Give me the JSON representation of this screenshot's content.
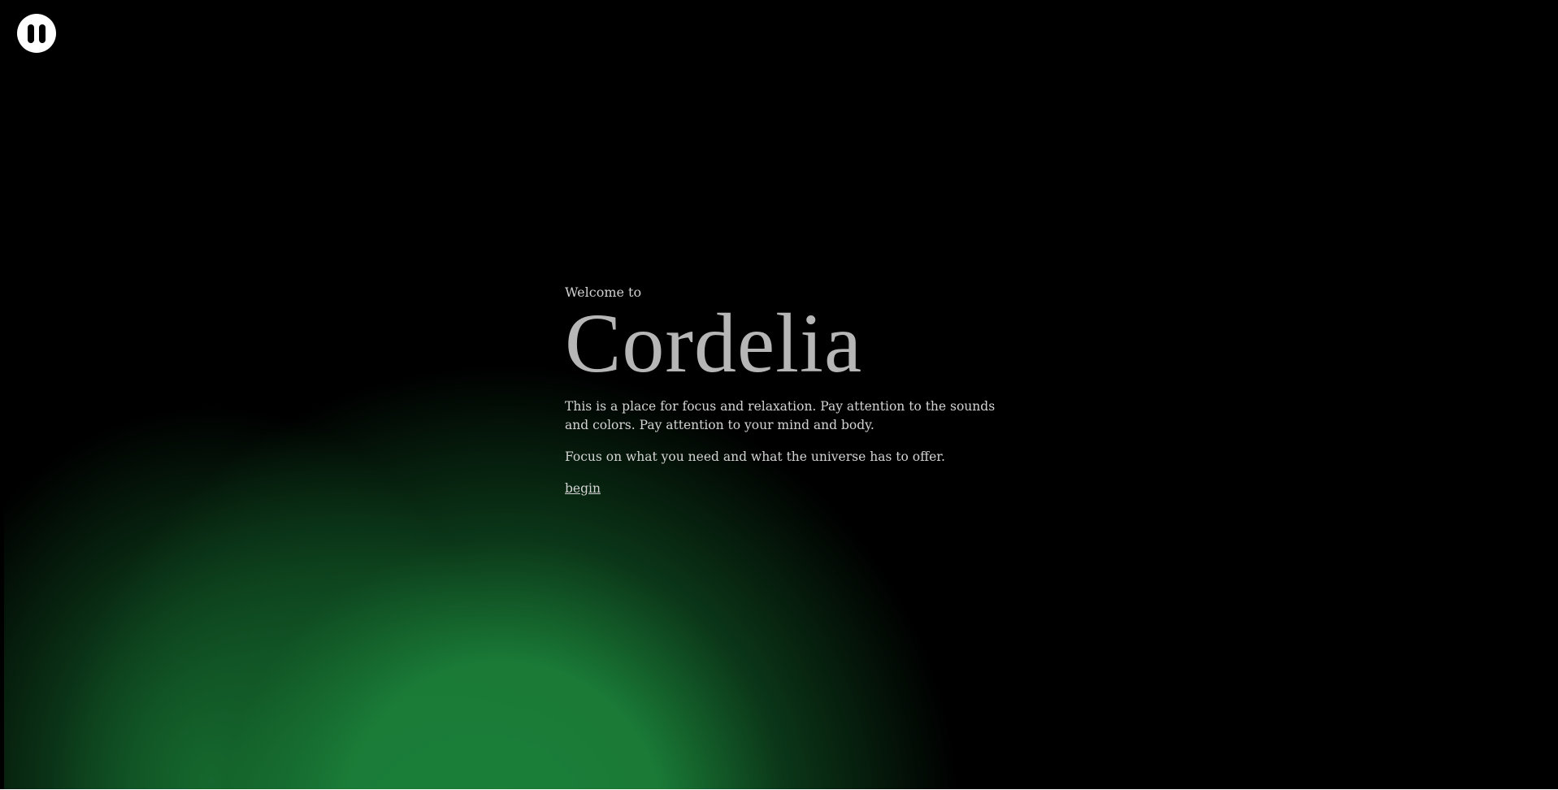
{
  "controls": {
    "pause_icon": "pause-icon"
  },
  "intro": {
    "welcome": "Welcome to",
    "title": "Cordelia",
    "paragraph1": "This is a place for focus and relaxation. Pay attention to the sounds and colors. Pay attention to your mind and body.",
    "paragraph2": "Focus on what you need and what the universe has to offer.",
    "begin_label": "begin"
  },
  "colors": {
    "background": "#000000",
    "glow": "#1b8039",
    "text": "#d4d4d4",
    "title": "#b6b6b6"
  }
}
